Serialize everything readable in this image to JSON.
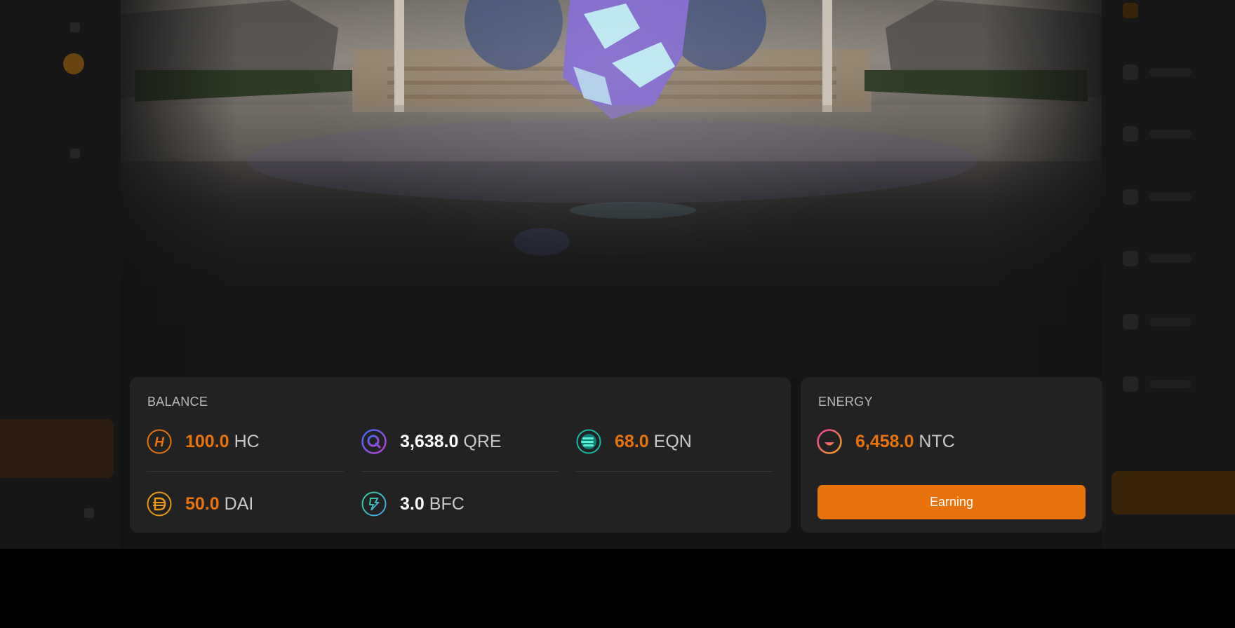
{
  "balance": {
    "title": "BALANCE",
    "tokens": [
      {
        "amount": "100.0",
        "symbol": "HC",
        "icon": "hc-coin-icon",
        "amount_color": "#e8720c"
      },
      {
        "amount": "3,638.0",
        "symbol": "QRE",
        "icon": "qre-coin-icon",
        "amount_color": "#ffffff"
      },
      {
        "amount": "68.0",
        "symbol": "EQN",
        "icon": "eqn-coin-icon",
        "amount_color": "#e8720c"
      },
      {
        "amount": "50.0",
        "symbol": "DAI",
        "icon": "dai-coin-icon",
        "amount_color": "#e8720c"
      },
      {
        "amount": "3.0",
        "symbol": "BFC",
        "icon": "bfc-coin-icon",
        "amount_color": "#ffffff"
      }
    ]
  },
  "energy": {
    "title": "ENERGY",
    "token": {
      "amount": "6,458.0",
      "symbol": "NTC",
      "icon": "ntc-coin-icon",
      "amount_color": "#e8720c"
    },
    "button_label": "Earning"
  },
  "colors": {
    "accent": "#e8720c",
    "panel": "#222222",
    "background": "#141414"
  }
}
